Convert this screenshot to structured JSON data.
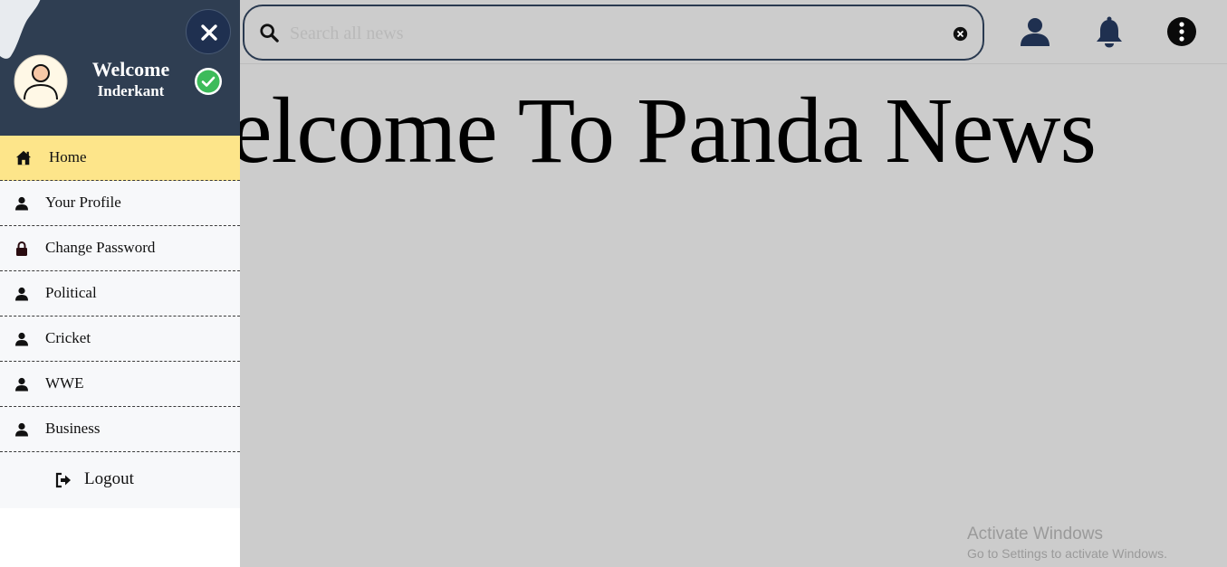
{
  "search": {
    "placeholder": "Search all news"
  },
  "hero": {
    "title": "Welcome To Panda News"
  },
  "user": {
    "greeting": "Welcome",
    "name": "Inderkant"
  },
  "menu": [
    {
      "label": "Home",
      "icon": "home-icon"
    },
    {
      "label": "Your Profile",
      "icon": "user-icon"
    },
    {
      "label": "Change Password",
      "icon": "lock-icon"
    },
    {
      "label": "Political",
      "icon": "user-icon"
    },
    {
      "label": "Cricket",
      "icon": "user-icon"
    },
    {
      "label": "WWE",
      "icon": "user-icon"
    },
    {
      "label": "Business",
      "icon": "user-icon"
    }
  ],
  "logout": {
    "label": "Logout",
    "icon": "sign-out-icon"
  },
  "watermark": {
    "line1": "Activate Windows",
    "line2": "Go to Settings to activate Windows."
  },
  "colors": {
    "sidebar_header": "#2f3e52",
    "active_item": "#fde58a",
    "overlay": "#cccccc",
    "navy": "#1f3050",
    "verified": "#3dbb5a"
  }
}
